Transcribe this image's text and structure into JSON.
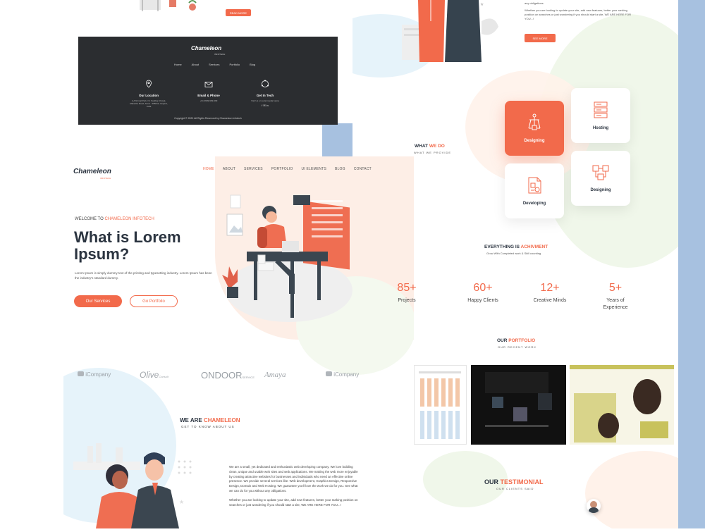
{
  "colors": {
    "accent": "#f26a4b",
    "dark": "#2b2d30",
    "blue_strip": "#a7c1e0",
    "peach": "#fdeee6",
    "mint": "#eef6e6",
    "sky": "#e6f3fa"
  },
  "top_left": {
    "button": "READ MORE"
  },
  "footer": {
    "logo": "Chameleon",
    "logo_sub": "INFOTECH",
    "nav": [
      "Home",
      "About",
      "Services",
      "Portfolio",
      "Blog"
    ],
    "location_title": "Our Location",
    "location_text": "4-A Nirmal Park, Nr. Sarkhej Chowk, Makarba Road, Surat - 395010, Gujarat, India",
    "email_title": "Email & Phone",
    "email_text": "+91 9999-999-999",
    "touch_title": "Get In Tech",
    "touch_text": "Visit Us or social media below",
    "copyright": "Copyright © 2021 All Rights Reserved by Chameleon Infotech"
  },
  "top_right": {
    "text1": "any obligations.",
    "text2": "Whether you are looking to update your site, add new features, better your ranking position on searches or just wondering if you should start a site, WE ARE HERE FOR YOU...!",
    "button": "SEE MORE"
  },
  "header": {
    "logo": "Chameleon",
    "logo_sub": "INFOTECH",
    "nav": [
      "HOME",
      "ABOUT",
      "SERVICES",
      "PORTFOLIO",
      "UI ELEMENTS",
      "BLOG",
      "CONTACT"
    ]
  },
  "hero": {
    "welcome_prefix": "WELCOME TO ",
    "welcome_brand": "CHAMELEON INFOTECH",
    "title_line1": "What is Lorem",
    "title_line2": "Ipsum?",
    "desc": "Lorem Ipsum is simply dummy text of the printing and typesetting industry. Lorem Ipsum has been the industry's standard dummy.",
    "btn_services": "Our Services",
    "btn_portfolio": "Go Portfolio"
  },
  "clients": [
    "iCompany",
    "Olive",
    "ONDOOR",
    "Amaya",
    "iCompany"
  ],
  "clients_sub": [
    "",
    "Consult",
    "SERVICE",
    "",
    ""
  ],
  "about": {
    "title_prefix": "WE ARE ",
    "title_brand": "CHAMELEON",
    "subtitle": "GET TO KNOW ABOUT US",
    "para1": "We are a small, yet dedicated and enthusiastic web developing company. We love building clean, unique and usable web sites and web applications. We making the web more enjoyable by creating attractive websites for businesses and individuals who need an effective online presence. We provide several services like: Web development, Graphics Design, Responsive Design, Domain and Web Hosting. We guarantee you'll love the work we do for you. See what we can do for you without any obligations.",
    "para2": "Whether you are looking to update your site, add new features, better your ranking position on searches or just wondering if you should start a site, WE ARE HERE FOR YOU...!"
  },
  "what_we_do": {
    "title_prefix": "WHAT ",
    "title_brand": "WE DO",
    "subtitle": "WHAT WE PROVIDE",
    "services": [
      "Designing",
      "Hosting",
      "Developing",
      "Designing"
    ]
  },
  "achievement": {
    "title_prefix": "EVERYTHING IS ",
    "title_brand": "ACHIVMENT",
    "subtitle": "Grow With Completed work & Skill counting",
    "stats": [
      {
        "num": "85+",
        "label": "Projects"
      },
      {
        "num": "60+",
        "label": "Happy Clients"
      },
      {
        "num": "12+",
        "label": "Creative Minds"
      },
      {
        "num": "5+",
        "label": "Years of Experience"
      }
    ]
  },
  "portfolio": {
    "title_prefix": "OUR ",
    "title_brand": "PORTFOLIO",
    "subtitle": "OUR RECENT WORK"
  },
  "testimonial": {
    "title_prefix": "OUR ",
    "title_brand": "TESTIMONIAL",
    "subtitle": "OUR CLIENTS SAID"
  }
}
